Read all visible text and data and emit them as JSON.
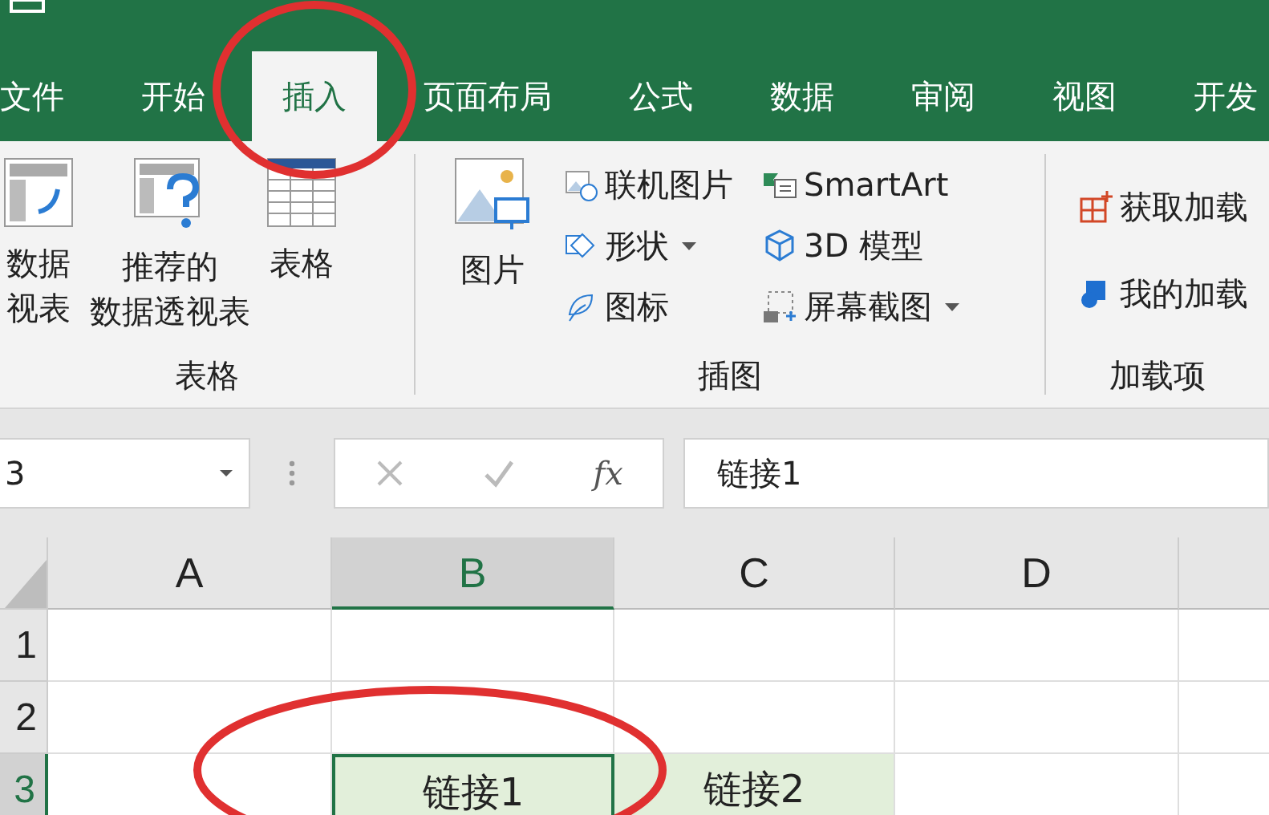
{
  "tabs": [
    {
      "label": "文件",
      "selected": false
    },
    {
      "label": "开始",
      "selected": false
    },
    {
      "label": "插入",
      "selected": true
    },
    {
      "label": "页面布局",
      "selected": false
    },
    {
      "label": "公式",
      "selected": false
    },
    {
      "label": "数据",
      "selected": false
    },
    {
      "label": "审阅",
      "selected": false
    },
    {
      "label": "视图",
      "selected": false
    },
    {
      "label": "开发",
      "selected": false
    }
  ],
  "ribbon": {
    "groups": [
      {
        "label": "表格",
        "large_buttons": [
          {
            "lines": [
              "数据",
              "视表"
            ]
          },
          {
            "lines": [
              "推荐的",
              "数据透视表"
            ]
          },
          {
            "lines": [
              "表格"
            ]
          }
        ]
      },
      {
        "label": "插图",
        "large_buttons": [
          {
            "lines": [
              "图片"
            ]
          }
        ],
        "small_columns": [
          [
            {
              "label": "联机图片",
              "dropdown": false
            },
            {
              "label": "形状",
              "dropdown": true
            },
            {
              "label": "图标",
              "dropdown": false
            }
          ],
          [
            {
              "label": "SmartArt",
              "dropdown": false
            },
            {
              "label": "3D 模型",
              "dropdown": false
            },
            {
              "label": "屏幕截图",
              "dropdown": true
            }
          ]
        ]
      },
      {
        "label": "加载项",
        "small_columns": [
          [
            {
              "label": "获取加载",
              "dropdown": false
            },
            {
              "label": "我的加载",
              "dropdown": false
            }
          ]
        ]
      }
    ]
  },
  "formula_bar": {
    "name_box": "3",
    "fx_label": "fx",
    "formula": "链接1"
  },
  "sheet": {
    "columns": [
      {
        "label": "A",
        "selected": false
      },
      {
        "label": "B",
        "selected": true
      },
      {
        "label": "C",
        "selected": false
      },
      {
        "label": "D",
        "selected": false
      }
    ],
    "rows": [
      {
        "header": "1",
        "selected": false
      },
      {
        "header": "2",
        "selected": false
      },
      {
        "header": "3",
        "selected": true,
        "cells": [
          {
            "text": "",
            "active": false,
            "highlighted": false
          },
          {
            "text": "链接1",
            "active": true,
            "highlighted": true
          },
          {
            "text": "链接2",
            "active": false,
            "highlighted": true
          }
        ]
      }
    ]
  }
}
